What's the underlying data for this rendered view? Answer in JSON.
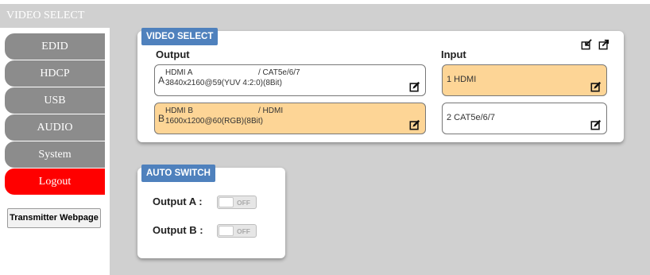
{
  "sidebar": {
    "header": "VIDEO SELECT",
    "items": [
      {
        "label": "EDID"
      },
      {
        "label": "HDCP"
      },
      {
        "label": "USB"
      },
      {
        "label": "AUDIO"
      },
      {
        "label": "System"
      },
      {
        "label": "Logout"
      }
    ],
    "transmitter_button": "Transmitter Webpage"
  },
  "video_select": {
    "title": "VIDEO SELECT",
    "output_heading": "Output",
    "input_heading": "Input",
    "icons": [
      "import-icon",
      "export-icon",
      "edit-icon"
    ],
    "outputs": [
      {
        "letter": "A",
        "name": "HDMI A",
        "route": "/ CAT5e/6/7",
        "format": "3840x2160@59(YUV 4:2:0)(8Bit)",
        "selected": false
      },
      {
        "letter": "B",
        "name": "HDMI B",
        "route": "/ HDMI",
        "format": "1600x1200@60(RGB)(8Bit)",
        "selected": true
      }
    ],
    "inputs": [
      {
        "label": "1  HDMI",
        "selected": true
      },
      {
        "label": "2  CAT5e/6/7",
        "selected": false
      }
    ]
  },
  "auto_switch": {
    "title": "AUTO SWITCH",
    "rows": [
      {
        "label": "Output A :",
        "state": "OFF"
      },
      {
        "label": "Output B :",
        "state": "OFF"
      }
    ]
  },
  "colors": {
    "accent": "#4f81bd",
    "selected": "#fdd596",
    "logout": "#ff0000",
    "nav": "#8c8c8c"
  }
}
